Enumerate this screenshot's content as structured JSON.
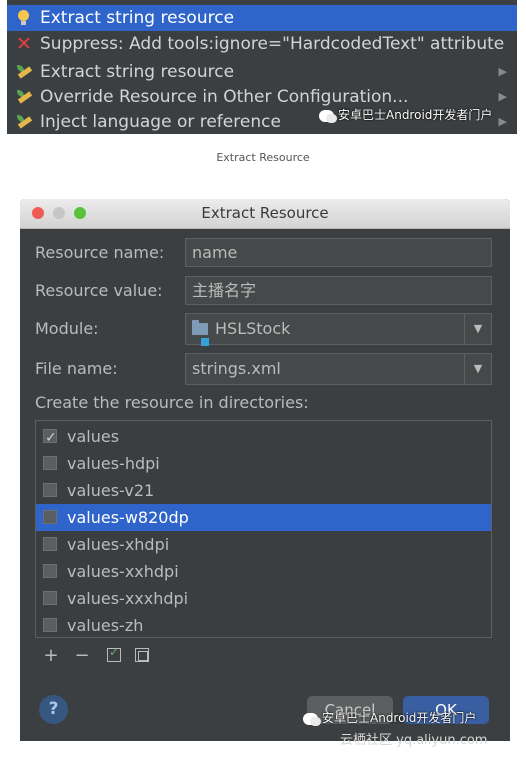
{
  "popup": {
    "items": [
      {
        "label": "Extract string resource",
        "icon": "lightbulb-icon",
        "selected": true,
        "submenu": false
      },
      {
        "label": "Suppress: Add tools:ignore=\"HardcodedText\" attribute",
        "icon": "red-x-icon",
        "selected": false,
        "submenu": false
      },
      {
        "label": "Extract string resource",
        "icon": "pencil-icon",
        "selected": false,
        "submenu": true
      },
      {
        "label": "Override Resource in Other Configuration...",
        "icon": "pencil-icon",
        "selected": false,
        "submenu": true
      },
      {
        "label": "Inject language or reference",
        "icon": "pencil-icon",
        "selected": false,
        "submenu": true
      }
    ],
    "submenu_arrow": "▶",
    "watermark": "安卓巴士Android开发者门户"
  },
  "caption": "Extract Resource",
  "dialog": {
    "title": "Extract Resource",
    "resource_name": {
      "label": "Resource name:",
      "value": "name"
    },
    "resource_value": {
      "label": "Resource value:",
      "value": "主播名字"
    },
    "module": {
      "label": "Module:",
      "value": "HSLStock"
    },
    "file_name": {
      "label": "File name:",
      "value": "strings.xml"
    },
    "dropdown_arrow": "▼",
    "directories_label": "Create the resource in directories:",
    "directories": [
      {
        "name": "values",
        "checked": true,
        "selected": false
      },
      {
        "name": "values-hdpi",
        "checked": false,
        "selected": false
      },
      {
        "name": "values-v21",
        "checked": false,
        "selected": false
      },
      {
        "name": "values-w820dp",
        "checked": false,
        "selected": true
      },
      {
        "name": "values-xhdpi",
        "checked": false,
        "selected": false
      },
      {
        "name": "values-xxhdpi",
        "checked": false,
        "selected": false
      },
      {
        "name": "values-xxxhdpi",
        "checked": false,
        "selected": false
      },
      {
        "name": "values-zh",
        "checked": false,
        "selected": false
      }
    ],
    "toolbar": {
      "add": "+",
      "remove": "−"
    },
    "help": "?",
    "cancel_label": "Cancel",
    "ok_label": "OK",
    "watermark": "安卓巴士Android开发者门户"
  },
  "footer_watermark": "云栖社区 yq.aliyun.com",
  "colors": {
    "selection": "#2f65ca",
    "panel": "#3c3f41",
    "text": "#bbbbbb"
  }
}
